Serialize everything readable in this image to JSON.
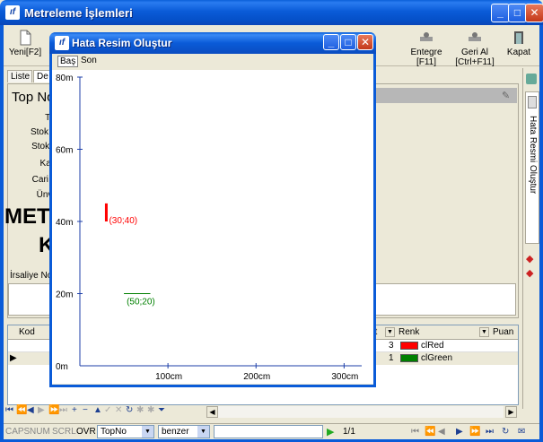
{
  "app": {
    "title": "Metreleme İşlemleri",
    "window_buttons": {
      "minimize": "_",
      "maximize": "□",
      "close": "✕"
    }
  },
  "toolbar": {
    "new_label": "Yeni[F2]",
    "integrate_label_1": "Entegre",
    "integrate_label_2": "[F11]",
    "undo_label_1": "Geri Al",
    "undo_label_2": "[Ctrl+F11]",
    "close_label": "Kapat"
  },
  "tabs": [
    "Liste",
    "De"
  ],
  "form": {
    "heading": "Top No",
    "labels": [
      "Tar",
      "Stok N",
      "Stok A",
      "Kalit",
      "Cari N",
      "Ünva"
    ],
    "big_text_1": "METR",
    "big_text_2": "K",
    "irsaliye_label": "İrsaliye No"
  },
  "side_tab": {
    "label": "Hata Resmi Oluştur"
  },
  "grid": {
    "columns": {
      "kod": "Kod",
      "adet": "et",
      "renk": "Renk",
      "puan": "Puan"
    },
    "rows": [
      {
        "adet": "3",
        "renk": "clRed",
        "color": "#ff0000"
      },
      {
        "adet": "1",
        "renk": "clGreen",
        "color": "#008000"
      }
    ]
  },
  "statusbar": {
    "caps": "CAPS",
    "num": "NUM",
    "scrl": "SCRL",
    "ovr": "OVR",
    "field_combo": "TopNo",
    "match_combo": "benzer",
    "search_value": "",
    "page": "1/1"
  },
  "dialog": {
    "title": "Hata Resim Oluştur",
    "menu": [
      "Baş",
      "Son"
    ],
    "chart_data": {
      "type": "scatter",
      "x_tick_labels": [
        "100cm",
        "200cm",
        "300cm"
      ],
      "x_ticks": [
        100,
        200,
        300
      ],
      "y_tick_labels": [
        "0m",
        "20m",
        "40m",
        "60m",
        "80m"
      ],
      "y_ticks": [
        0,
        20,
        40,
        60,
        80
      ],
      "xlim": [
        0,
        320
      ],
      "ylim": [
        0,
        80
      ],
      "series": [
        {
          "label": "(30;40)",
          "x": 30,
          "y": 40,
          "orientation": "vertical",
          "extent": 5,
          "color": "#ff0000"
        },
        {
          "label": "(50;20)",
          "x": 50,
          "y": 20,
          "orientation": "horizontal",
          "extent": 30,
          "color": "#008000"
        }
      ]
    }
  }
}
